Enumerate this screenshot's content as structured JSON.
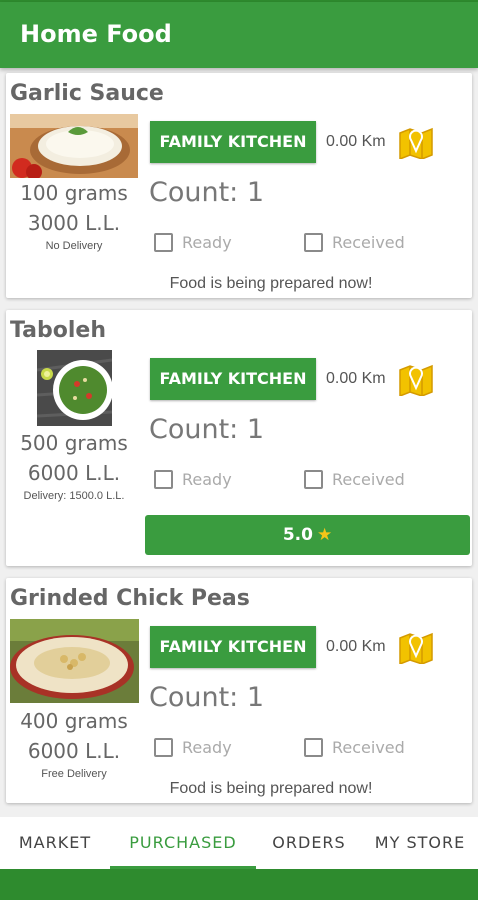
{
  "app": {
    "title": "Home Food"
  },
  "orders": [
    {
      "name": "Garlic Sauce",
      "image_icon": "garlic-sauce-photo",
      "quantity": "100 grams",
      "price": "3000 L.L.",
      "delivery": "No Delivery",
      "kitchen_label": "FAMILY KITCHEN",
      "distance": "0.00 Km",
      "count": "Count: 1",
      "ready_label": "Ready",
      "received_label": "Received",
      "status": "Food is being prepared now!"
    },
    {
      "name": "Taboleh",
      "image_icon": "taboleh-photo",
      "quantity": "500 grams",
      "price": "6000 L.L.",
      "delivery": "Delivery: 1500.0 L.L.",
      "kitchen_label": "FAMILY KITCHEN",
      "distance": "0.00 Km",
      "count": "Count: 1",
      "ready_label": "Ready",
      "received_label": "Received",
      "rating": "5.0",
      "rating_icon": "★"
    },
    {
      "name": "Grinded Chick Peas",
      "image_icon": "hummus-photo",
      "quantity": "400 grams",
      "price": "6000 L.L.",
      "delivery": "Free Delivery",
      "kitchen_label": "FAMILY KITCHEN",
      "distance": "0.00 Km",
      "count": "Count: 1",
      "ready_label": "Ready",
      "received_label": "Received",
      "status": "Food is being prepared now!"
    }
  ],
  "tabs": [
    {
      "label": "MARKET",
      "active": false
    },
    {
      "label": "PURCHASED",
      "active": true
    },
    {
      "label": "ORDERS",
      "active": false
    },
    {
      "label": "MY STORE",
      "active": false
    }
  ],
  "colors": {
    "primary": "#3a9c3f",
    "primary_dark": "#2e8b2e",
    "star": "#f5c518"
  }
}
